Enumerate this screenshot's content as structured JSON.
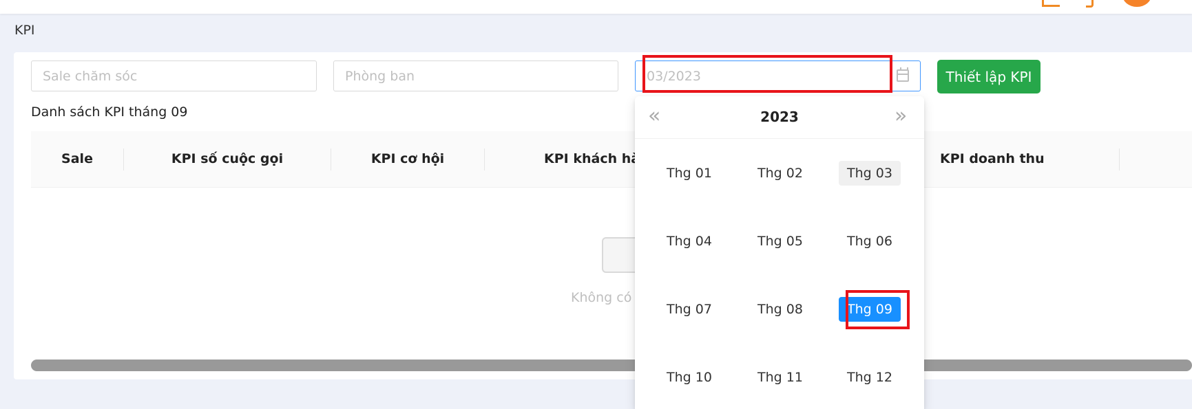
{
  "breadcrumb": "KPI",
  "filters": {
    "sale_placeholder": "Sale chăm sóc",
    "department_placeholder": "Phòng ban",
    "date_placeholder": "03/2023"
  },
  "setup_button_label": "Thiết lập KPI",
  "list_title": "Danh sách KPI tháng 09",
  "table": {
    "columns": [
      "Sale",
      "KPI số cuộc gọi",
      "KPI cơ hội",
      "KPI khách hàn",
      "KPI doanh thu"
    ],
    "empty_text": "Không có"
  },
  "picker": {
    "year": "2023",
    "prev_label": "«",
    "next_label": "»",
    "months": [
      "Thg 01",
      "Thg 02",
      "Thg 03",
      "Thg 04",
      "Thg 05",
      "Thg 06",
      "Thg 07",
      "Thg 08",
      "Thg 09",
      "Thg 10",
      "Thg 11",
      "Thg 12"
    ],
    "current_month": "Thg 03",
    "selected_month": "Thg 09"
  },
  "colors": {
    "accent": "#1890ff",
    "setup_button": "#27a74a",
    "highlight": "#e8141a",
    "header_icons": "#f08a24"
  },
  "icons": [
    "edit-icon",
    "phone-icon",
    "avatar",
    "calendar-icon",
    "double-left-icon",
    "double-right-icon",
    "empty-inbox-icon"
  ]
}
